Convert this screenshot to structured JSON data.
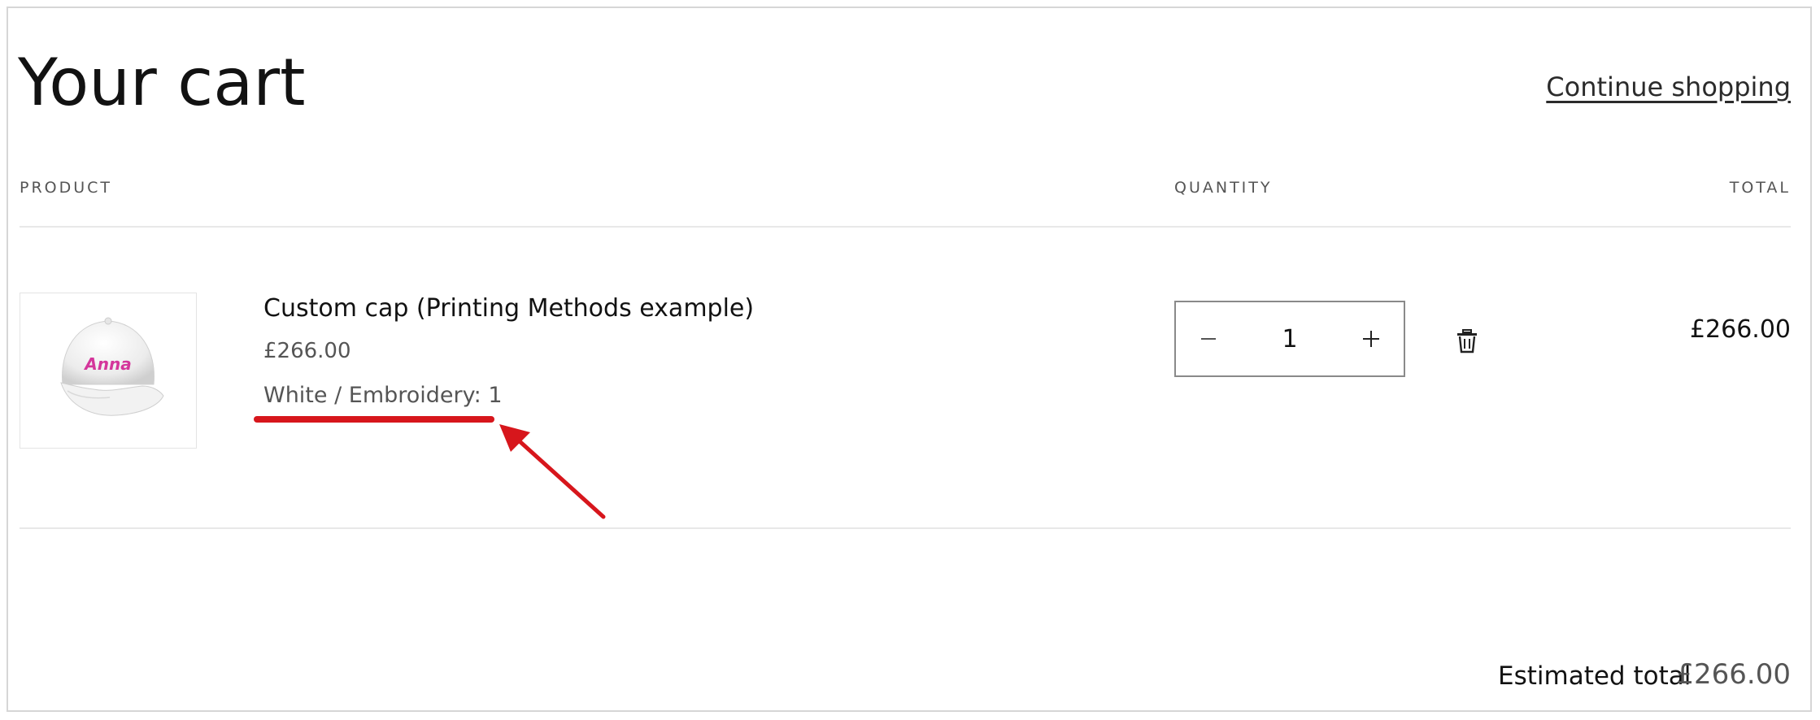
{
  "page": {
    "title": "Your cart",
    "continue_label": "Continue shopping"
  },
  "table": {
    "headers": {
      "product": "PRODUCT",
      "quantity": "QUANTITY",
      "total": "TOTAL"
    }
  },
  "items": [
    {
      "name": "Custom cap (Printing Methods example)",
      "unit_price": "£266.00",
      "variant": "White / Embroidery: 1",
      "quantity": "1",
      "line_total": "£266.00",
      "image": {
        "icon": "cap-image",
        "embroidery_text": "Anna",
        "embroidery_color": "#d4369b"
      }
    }
  ],
  "controls": {
    "decrease_icon": "minus-icon",
    "increase_icon": "plus-icon",
    "remove_icon": "trash-icon"
  },
  "summary": {
    "estimated_total_label": "Estimated total",
    "estimated_total_value": "£266.00"
  },
  "annotation": {
    "color": "#d7161c"
  }
}
